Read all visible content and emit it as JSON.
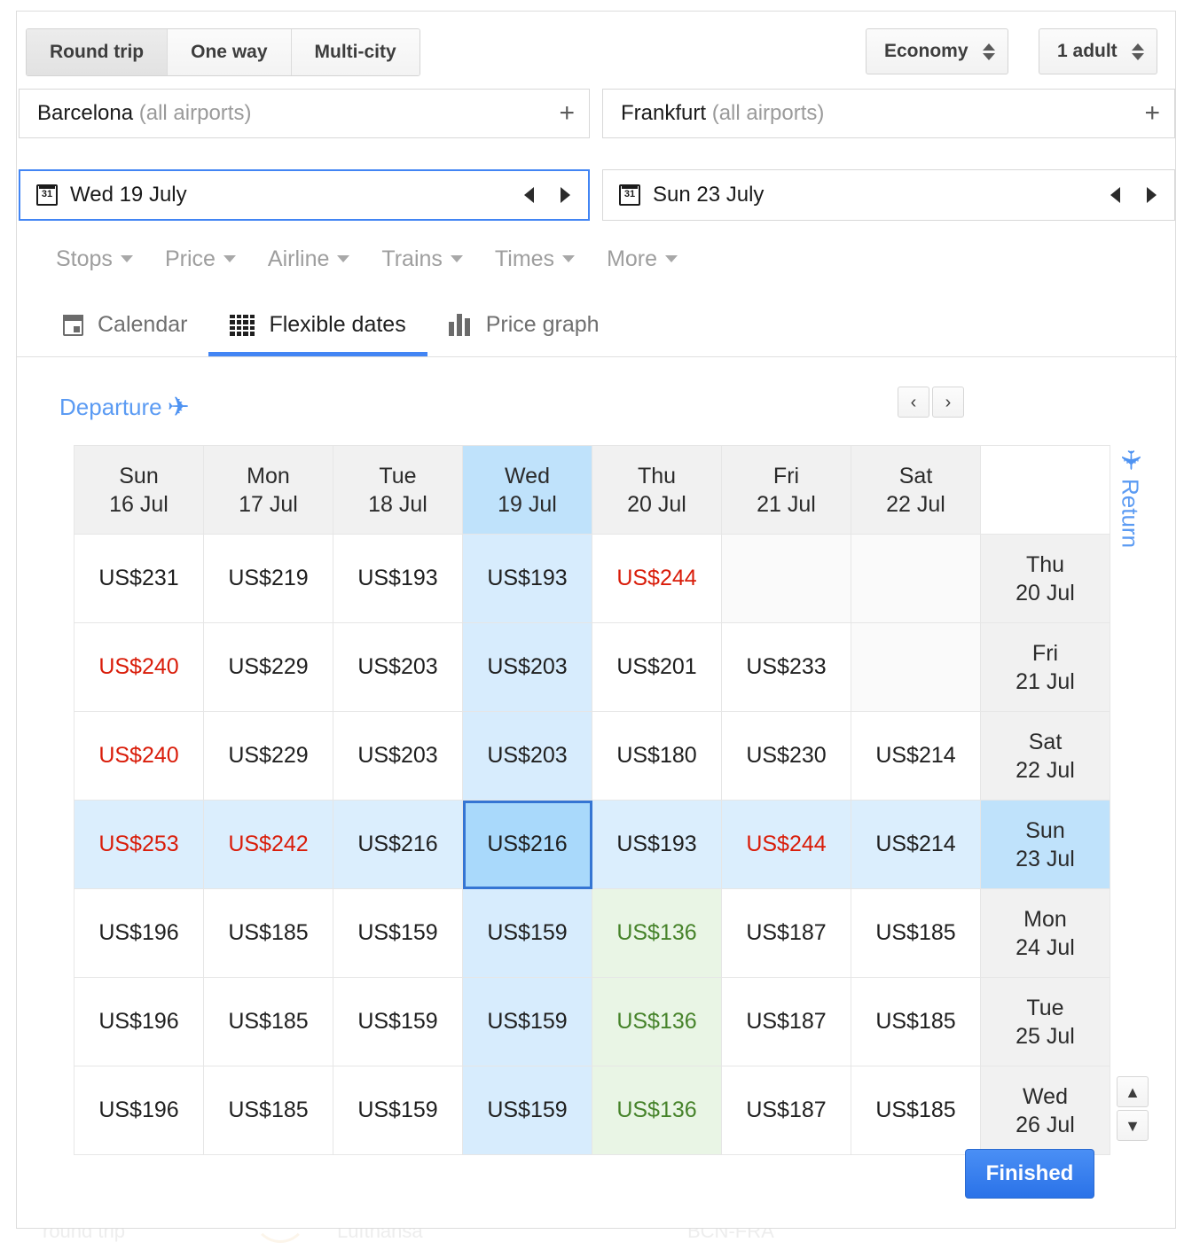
{
  "trip_types": [
    {
      "label": "Round trip",
      "active": true
    },
    {
      "label": "One way",
      "active": false
    },
    {
      "label": "Multi-city",
      "active": false
    }
  ],
  "cabin": {
    "label": "Economy"
  },
  "passengers": {
    "label": "1 adult"
  },
  "origin": {
    "city": "Barcelona",
    "qualifier": "(all airports)",
    "add_label": "+"
  },
  "destination": {
    "city": "Frankfurt",
    "qualifier": "(all airports)",
    "add_label": "+"
  },
  "depart_date": {
    "value": "Wed 19 July"
  },
  "return_date": {
    "value": "Sun 23 July"
  },
  "filters": [
    {
      "label": "Stops"
    },
    {
      "label": "Price"
    },
    {
      "label": "Airline"
    },
    {
      "label": "Trains"
    },
    {
      "label": "Times"
    },
    {
      "label": "More"
    }
  ],
  "tabs": [
    {
      "label": "Calendar",
      "icon": "calendar-icon",
      "active": false
    },
    {
      "label": "Flexible dates",
      "icon": "grid-icon",
      "active": true
    },
    {
      "label": "Price graph",
      "icon": "bar-chart-icon",
      "active": false
    }
  ],
  "matrix": {
    "departure_label": "Departure",
    "return_label": "Return",
    "pager": {
      "prev": "‹",
      "next": "›"
    },
    "vscroll": {
      "up": "⌃",
      "down": "⌄"
    },
    "finished_label": "Finished",
    "selected_departure": "Wed 19 Jul",
    "selected_return": "Sun 23 Jul",
    "columns": [
      {
        "dow": "Sun",
        "date": "16 Jul",
        "selected": false
      },
      {
        "dow": "Mon",
        "date": "17 Jul",
        "selected": false
      },
      {
        "dow": "Tue",
        "date": "18 Jul",
        "selected": false
      },
      {
        "dow": "Wed",
        "date": "19 Jul",
        "selected": true
      },
      {
        "dow": "Thu",
        "date": "20 Jul",
        "selected": false
      },
      {
        "dow": "Fri",
        "date": "21 Jul",
        "selected": false
      },
      {
        "dow": "Sat",
        "date": "22 Jul",
        "selected": false
      }
    ],
    "rows": [
      {
        "dow": "Thu",
        "date": "20 Jul",
        "selected": false
      },
      {
        "dow": "Fri",
        "date": "21 Jul",
        "selected": false
      },
      {
        "dow": "Sat",
        "date": "22 Jul",
        "selected": false
      },
      {
        "dow": "Sun",
        "date": "23 Jul",
        "selected": true
      },
      {
        "dow": "Mon",
        "date": "24 Jul",
        "selected": false
      },
      {
        "dow": "Tue",
        "date": "25 Jul",
        "selected": false
      },
      {
        "dow": "Wed",
        "date": "26 Jul",
        "selected": false
      }
    ],
    "cells": [
      [
        {
          "text": "US$231",
          "tone": "normal"
        },
        {
          "text": "US$219",
          "tone": "normal"
        },
        {
          "text": "US$193",
          "tone": "normal"
        },
        {
          "text": "US$193",
          "tone": "normal"
        },
        {
          "text": "US$244",
          "tone": "high"
        },
        {
          "text": "",
          "tone": "empty"
        },
        {
          "text": "",
          "tone": "empty"
        }
      ],
      [
        {
          "text": "US$240",
          "tone": "high"
        },
        {
          "text": "US$229",
          "tone": "normal"
        },
        {
          "text": "US$203",
          "tone": "normal"
        },
        {
          "text": "US$203",
          "tone": "normal"
        },
        {
          "text": "US$201",
          "tone": "normal"
        },
        {
          "text": "US$233",
          "tone": "normal"
        },
        {
          "text": "",
          "tone": "empty"
        }
      ],
      [
        {
          "text": "US$240",
          "tone": "high"
        },
        {
          "text": "US$229",
          "tone": "normal"
        },
        {
          "text": "US$203",
          "tone": "normal"
        },
        {
          "text": "US$203",
          "tone": "normal"
        },
        {
          "text": "US$180",
          "tone": "normal"
        },
        {
          "text": "US$230",
          "tone": "normal"
        },
        {
          "text": "US$214",
          "tone": "normal"
        }
      ],
      [
        {
          "text": "US$253",
          "tone": "high"
        },
        {
          "text": "US$242",
          "tone": "high"
        },
        {
          "text": "US$216",
          "tone": "normal"
        },
        {
          "text": "US$216",
          "tone": "normal",
          "selected": true
        },
        {
          "text": "US$193",
          "tone": "normal"
        },
        {
          "text": "US$244",
          "tone": "high"
        },
        {
          "text": "US$214",
          "tone": "normal"
        }
      ],
      [
        {
          "text": "US$196",
          "tone": "normal"
        },
        {
          "text": "US$185",
          "tone": "normal"
        },
        {
          "text": "US$159",
          "tone": "normal"
        },
        {
          "text": "US$159",
          "tone": "normal"
        },
        {
          "text": "US$136",
          "tone": "low"
        },
        {
          "text": "US$187",
          "tone": "normal"
        },
        {
          "text": "US$185",
          "tone": "normal"
        }
      ],
      [
        {
          "text": "US$196",
          "tone": "normal"
        },
        {
          "text": "US$185",
          "tone": "normal"
        },
        {
          "text": "US$159",
          "tone": "normal"
        },
        {
          "text": "US$159",
          "tone": "normal"
        },
        {
          "text": "US$136",
          "tone": "low"
        },
        {
          "text": "US$187",
          "tone": "normal"
        },
        {
          "text": "US$185",
          "tone": "normal"
        }
      ],
      [
        {
          "text": "US$196",
          "tone": "normal"
        },
        {
          "text": "US$185",
          "tone": "normal"
        },
        {
          "text": "US$159",
          "tone": "normal"
        },
        {
          "text": "US$159",
          "tone": "normal"
        },
        {
          "text": "US$136",
          "tone": "low"
        },
        {
          "text": "US$187",
          "tone": "normal"
        },
        {
          "text": "US$185",
          "tone": "normal"
        }
      ]
    ]
  },
  "background_ghost": {
    "trip": "round trip",
    "airline": "Lufthansa",
    "route": "BCN-FRA"
  },
  "colors": {
    "accent_blue": "#4285f4",
    "selected_cell": "#a9d9fb",
    "selected_header": "#bfe2fb",
    "price_high": "#d91c09",
    "price_low": "#46832a",
    "cheap_cell": "#e9f5e5"
  }
}
